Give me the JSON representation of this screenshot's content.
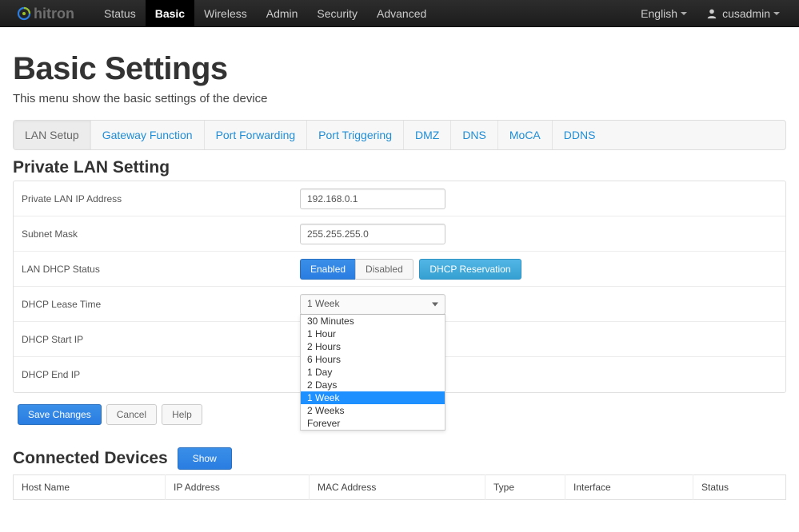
{
  "navbar": {
    "brand": "hitron",
    "items": [
      {
        "label": "Status",
        "active": false
      },
      {
        "label": "Basic",
        "active": true
      },
      {
        "label": "Wireless",
        "active": false
      },
      {
        "label": "Admin",
        "active": false
      },
      {
        "label": "Security",
        "active": false
      },
      {
        "label": "Advanced",
        "active": false
      }
    ],
    "language": "English",
    "username": "cusadmin"
  },
  "page": {
    "title": "Basic Settings",
    "subtitle": "This menu show the basic settings of the device"
  },
  "tabs": [
    {
      "label": "LAN Setup",
      "active": true
    },
    {
      "label": "Gateway Function",
      "active": false
    },
    {
      "label": "Port Forwarding",
      "active": false
    },
    {
      "label": "Port Triggering",
      "active": false
    },
    {
      "label": "DMZ",
      "active": false
    },
    {
      "label": "DNS",
      "active": false
    },
    {
      "label": "MoCA",
      "active": false
    },
    {
      "label": "DDNS",
      "active": false
    }
  ],
  "section_private_lan_title": "Private LAN Setting",
  "form": {
    "private_lan_ip": {
      "label": "Private LAN IP Address",
      "value": "192.168.0.1"
    },
    "subnet_mask": {
      "label": "Subnet Mask",
      "value": "255.255.255.0"
    },
    "lan_dhcp_status": {
      "label": "LAN DHCP Status",
      "enabled_label": "Enabled",
      "disabled_label": "Disabled",
      "reservation_label": "DHCP Reservation"
    },
    "dhcp_lease_time": {
      "label": "DHCP Lease Time",
      "selected": "1 Week",
      "options": [
        "30 Minutes",
        "1 Hour",
        "2 Hours",
        "6 Hours",
        "1 Day",
        "2 Days",
        "1 Week",
        "2 Weeks",
        "Forever"
      ]
    },
    "dhcp_start_ip": {
      "label": "DHCP Start IP"
    },
    "dhcp_end_ip": {
      "label": "DHCP End IP"
    }
  },
  "actions": {
    "save": "Save Changes",
    "cancel": "Cancel",
    "help": "Help"
  },
  "connected": {
    "title": "Connected Devices",
    "show_label": "Show",
    "columns": [
      "Host Name",
      "IP Address",
      "MAC Address",
      "Type",
      "Interface",
      "Status"
    ]
  },
  "colors": {
    "primary": "#2a7de1",
    "info": "#3aa7d9",
    "link": "#1f8dd6",
    "navbar_bg": "#222222"
  }
}
